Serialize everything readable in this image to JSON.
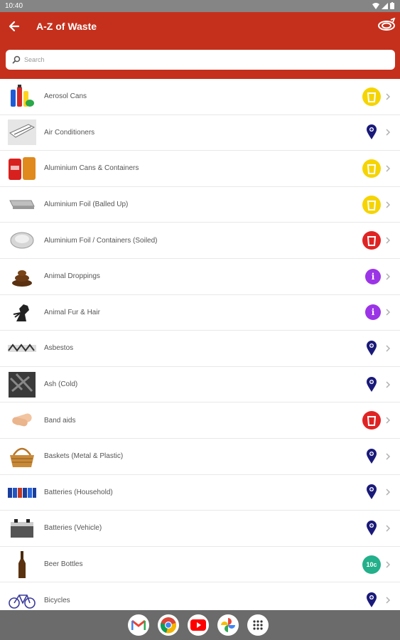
{
  "status_bar": {
    "time": "10:40"
  },
  "app_bar": {
    "title": "A-Z of Waste"
  },
  "search": {
    "placeholder": "Search"
  },
  "colors": {
    "header": "#c5301c",
    "yellow_bin": "#f5d400",
    "red_bin": "#e02424",
    "info": "#9b34e6",
    "location": "#1a1a7a",
    "deposit": "#23b08a"
  },
  "items": [
    {
      "label": "Aerosol Cans",
      "thumb": "aerosol-cans-icon",
      "badge": "yellow-bin"
    },
    {
      "label": "Air Conditioners",
      "thumb": "air-conditioner-icon",
      "badge": "location"
    },
    {
      "label": "Aluminium Cans & Containers",
      "thumb": "aluminium-cans-icon",
      "badge": "yellow-bin"
    },
    {
      "label": "Aluminium Foil (Balled Up)",
      "thumb": "aluminium-foil-icon",
      "badge": "yellow-bin"
    },
    {
      "label": "Aluminium Foil / Containers (Soiled)",
      "thumb": "foil-container-icon",
      "badge": "red-bin"
    },
    {
      "label": "Animal Droppings",
      "thumb": "animal-droppings-icon",
      "badge": "info"
    },
    {
      "label": "Animal Fur & Hair",
      "thumb": "animal-fur-icon",
      "badge": "info"
    },
    {
      "label": "Asbestos",
      "thumb": "asbestos-icon",
      "badge": "location"
    },
    {
      "label": "Ash (Cold)",
      "thumb": "ash-icon",
      "badge": "location"
    },
    {
      "label": "Band aids",
      "thumb": "band-aids-icon",
      "badge": "red-bin"
    },
    {
      "label": "Baskets (Metal & Plastic)",
      "thumb": "basket-icon",
      "badge": "location"
    },
    {
      "label": "Batteries (Household)",
      "thumb": "household-batteries-icon",
      "badge": "location"
    },
    {
      "label": "Batteries (Vehicle)",
      "thumb": "vehicle-battery-icon",
      "badge": "location"
    },
    {
      "label": "Beer Bottles",
      "thumb": "beer-bottle-icon",
      "badge": "deposit",
      "badge_text": "10c"
    },
    {
      "label": "Bicycles",
      "thumb": "bicycle-icon",
      "badge": "location"
    }
  ],
  "dock": [
    "gmail-icon",
    "chrome-icon",
    "youtube-icon",
    "photos-icon",
    "app-drawer-icon"
  ]
}
